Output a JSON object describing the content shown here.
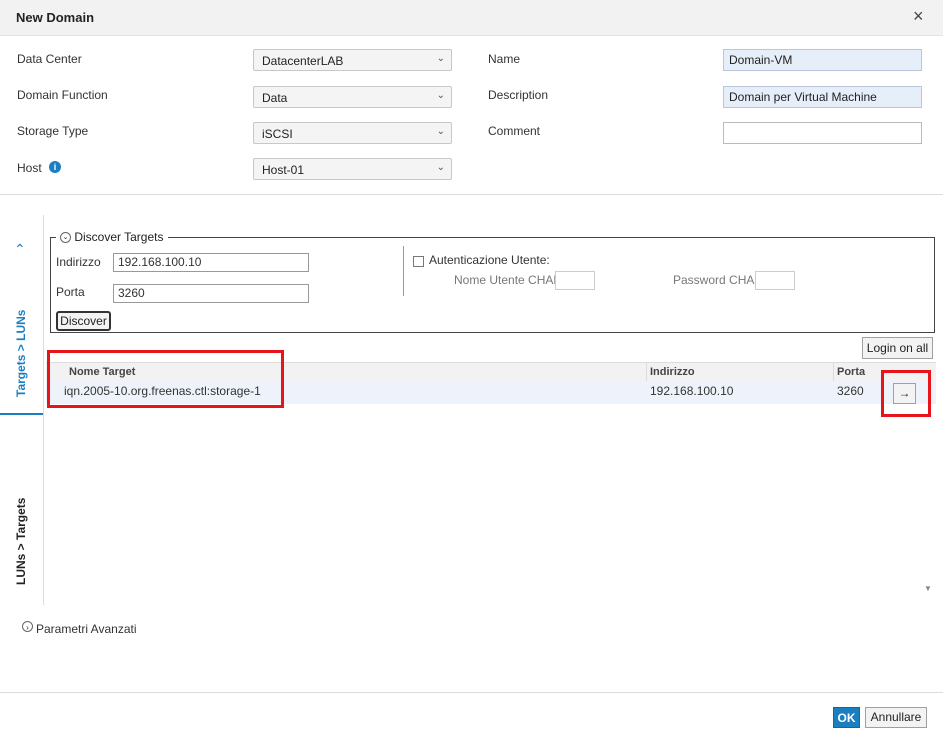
{
  "dialog": {
    "title": "New Domain",
    "close": "×"
  },
  "form": {
    "data_center": {
      "label": "Data Center",
      "value": "DatacenterLAB"
    },
    "domain_function": {
      "label": "Domain Function",
      "value": "Data"
    },
    "storage_type": {
      "label": "Storage Type",
      "value": "iSCSI"
    },
    "host": {
      "label": "Host",
      "value": "Host-01"
    },
    "name": {
      "label": "Name",
      "value": "Domain-VM"
    },
    "description": {
      "label": "Description",
      "value": "Domain per Virtual Machine"
    },
    "comment": {
      "label": "Comment",
      "value": ""
    }
  },
  "tabs": {
    "targets_luns": "Targets > LUNs",
    "luns_targets": "LUNs > Targets"
  },
  "discover": {
    "legend": "Discover Targets",
    "address_label": "Indirizzo",
    "address_value": "192.168.100.10",
    "port_label": "Porta",
    "port_value": "3260",
    "button": "Discover",
    "auth_label": "Autenticazione Utente:",
    "chap_user_label": "Nome Utente CHAP",
    "chap_password_label": "Password CHAP"
  },
  "login_all": "Login on all",
  "table": {
    "columns": [
      "Nome Target",
      "Indirizzo",
      "Porta"
    ],
    "rows": [
      {
        "target": "iqn.2005-10.org.freenas.ctl:storage-1",
        "address": "192.168.100.10",
        "port": "3260"
      }
    ]
  },
  "advanced": "Parametri Avanzati",
  "footer": {
    "ok": "OK",
    "cancel": "Annullare"
  },
  "colors": {
    "accent": "#1a7fc1",
    "highlight": "#e8141c",
    "ok_button": "#1a7fc1"
  }
}
